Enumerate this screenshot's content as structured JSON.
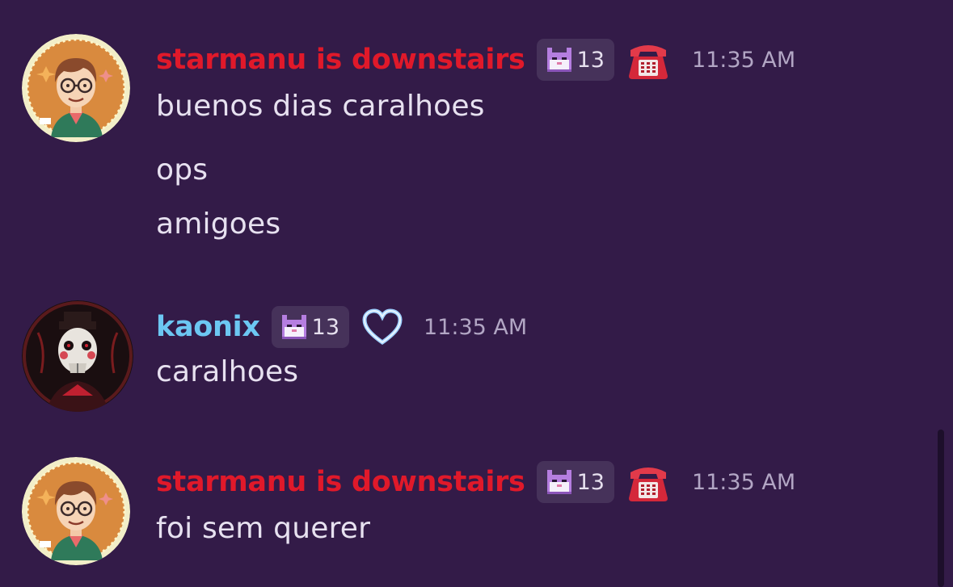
{
  "messages": [
    {
      "author": "starmanu is downstairs",
      "author_color": "#e0192a",
      "badge_count": "13",
      "badge_icon": "pixel-cat-icon",
      "role_icon": "telephone-icon",
      "timestamp": "11:35 AM",
      "lines": [
        "buenos dias caralhoes",
        "ops",
        "amigoes"
      ]
    },
    {
      "author": "kaonix",
      "author_color": "#6cc7f2",
      "badge_count": "13",
      "badge_icon": "pixel-cat-icon",
      "role_icon": "heart-icon",
      "timestamp": "11:35 AM",
      "lines": [
        "caralhoes"
      ]
    },
    {
      "author": "starmanu is downstairs",
      "author_color": "#e0192a",
      "badge_count": "13",
      "badge_icon": "pixel-cat-icon",
      "role_icon": "telephone-icon",
      "timestamp": "11:35 AM",
      "lines": [
        "foi sem querer"
      ]
    }
  ],
  "theme": {
    "background": "#331b48",
    "message_text": "#e7e1f0",
    "timestamp_text": "#b2a6c4",
    "badge_background": "#46325a"
  }
}
